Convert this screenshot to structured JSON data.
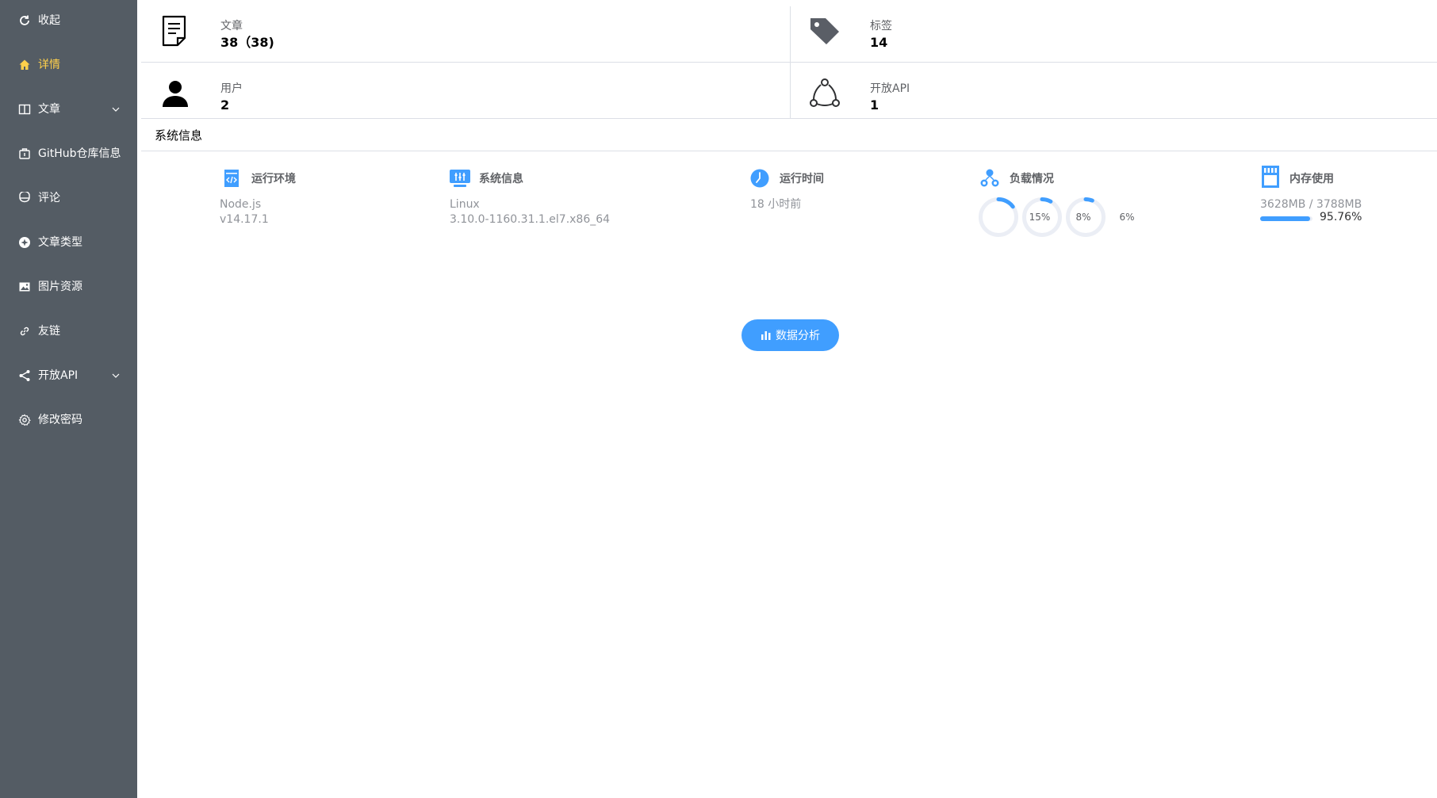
{
  "sidebar": {
    "items": [
      {
        "label": "收起",
        "icon": "refresh-icon",
        "active": false
      },
      {
        "label": "详情",
        "icon": "home-icon",
        "active": true
      },
      {
        "label": "文章",
        "icon": "book-icon",
        "active": false,
        "has_submenu": true
      },
      {
        "label": "GitHub仓库信息",
        "icon": "repository-icon",
        "active": false
      },
      {
        "label": "评论",
        "icon": "comment-icon",
        "active": false
      },
      {
        "label": "文章类型",
        "icon": "category-icon",
        "active": false
      },
      {
        "label": "图片资源",
        "icon": "image-icon",
        "active": false
      },
      {
        "label": "友链",
        "icon": "link-icon",
        "active": false
      },
      {
        "label": "开放API",
        "icon": "share-icon",
        "active": false,
        "has_submenu": true
      },
      {
        "label": "修改密码",
        "icon": "gear-icon",
        "active": false
      }
    ],
    "active_color": "#ffd04b",
    "background": "#545c64"
  },
  "stats": {
    "articles": {
      "label": "文章",
      "value": "38（38)",
      "icon": "document-icon"
    },
    "tags": {
      "label": "标签",
      "value": "14",
      "icon": "tag-icon"
    },
    "users": {
      "label": "用户",
      "value": "2",
      "icon": "user-icon"
    },
    "open_api": {
      "label": "开放API",
      "value": "1",
      "icon": "api-share-icon"
    }
  },
  "system": {
    "section_title": "系统信息",
    "runtime": {
      "title": "运行环境",
      "line1": "Node.js",
      "line2": "v14.17.1",
      "icon": "code-file-icon"
    },
    "os": {
      "title": "系统信息",
      "line1": "Linux",
      "line2": "3.10.0-1160.31.1.el7.x86_64",
      "icon": "server-icon"
    },
    "uptime": {
      "title": "运行时间",
      "line1": "18 小时前",
      "icon": "clock-icon"
    },
    "load": {
      "title": "负载情况",
      "icon": "cluster-icon",
      "values": [
        {
          "label": "15%",
          "percent": 15
        },
        {
          "label": "8%",
          "percent": 8
        },
        {
          "label": "6%",
          "percent": 6
        }
      ]
    },
    "memory": {
      "title": "内存使用",
      "line1": "3628MB / 3788MB",
      "percent_label": "95.76%",
      "percent": 95.76,
      "icon": "memory-card-icon"
    }
  },
  "actions": {
    "analyze_label": "数据分析",
    "analyze_icon": "bar-chart-icon"
  },
  "colors": {
    "accent": "#409eff"
  }
}
